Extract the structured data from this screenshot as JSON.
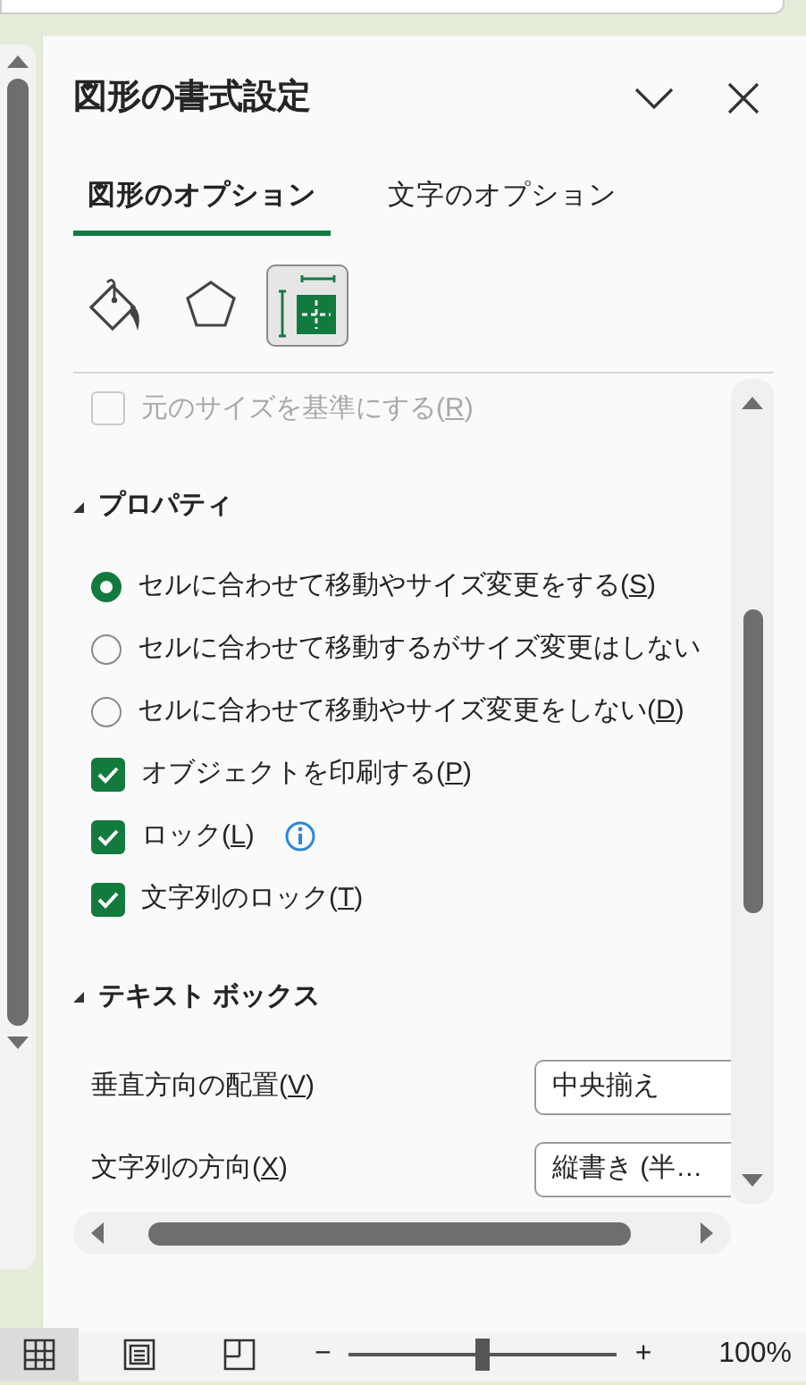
{
  "task_pane": {
    "title": "図形の書式設定",
    "tabs": [
      {
        "label": "図形のオプション",
        "selected": true
      },
      {
        "label": "文字のオプション",
        "selected": false
      }
    ],
    "categories": [
      {
        "kind": "fill",
        "selected": false
      },
      {
        "kind": "shape",
        "selected": false
      },
      {
        "kind": "size",
        "selected": true
      }
    ],
    "top_option": {
      "kind": "checkbox",
      "before": "元のサイズを基準にする(",
      "key": "R",
      "after": ")",
      "checked": false,
      "disabled": true
    },
    "sections": [
      {
        "title": "プロパティ",
        "expanded": true,
        "items": [
          {
            "kind": "radio",
            "before": "セルに合わせて移動やサイズ変更をする(",
            "key": "S",
            "after": ")",
            "selected": true
          },
          {
            "kind": "radio",
            "before": "セルに合わせて移動するがサイズ変更はしない",
            "selected": false
          },
          {
            "kind": "radio",
            "before": "セルに合わせて移動やサイズ変更をしない(",
            "key": "D",
            "after": ")",
            "selected": false
          },
          {
            "kind": "checkbox",
            "before": "オブジェクトを印刷する(",
            "key": "P",
            "after": ")",
            "checked": true
          },
          {
            "kind": "checkbox",
            "before": "ロック(",
            "key": "L",
            "after": ")",
            "checked": true,
            "info": true
          },
          {
            "kind": "checkbox",
            "before": "文字列のロック(",
            "key": "T",
            "after": ")",
            "checked": true
          }
        ]
      },
      {
        "title": "テキスト ボックス",
        "expanded": true,
        "items": [
          {
            "kind": "dropdown",
            "before": "垂直方向の配置(",
            "key": "V",
            "after": ")",
            "value": "中央揃え"
          },
          {
            "kind": "dropdown",
            "before": "文字列の方向(",
            "key": "X",
            "after": ")",
            "value": "縦書き (半…"
          }
        ]
      }
    ]
  },
  "status_bar": {
    "views": [
      {
        "kind": "normal",
        "selected": true
      },
      {
        "kind": "page_layout",
        "selected": false
      },
      {
        "kind": "page_break",
        "selected": false
      }
    ],
    "zoom": {
      "minus": "−",
      "plus": "+",
      "level": 0.5,
      "reading": "100%"
    }
  }
}
